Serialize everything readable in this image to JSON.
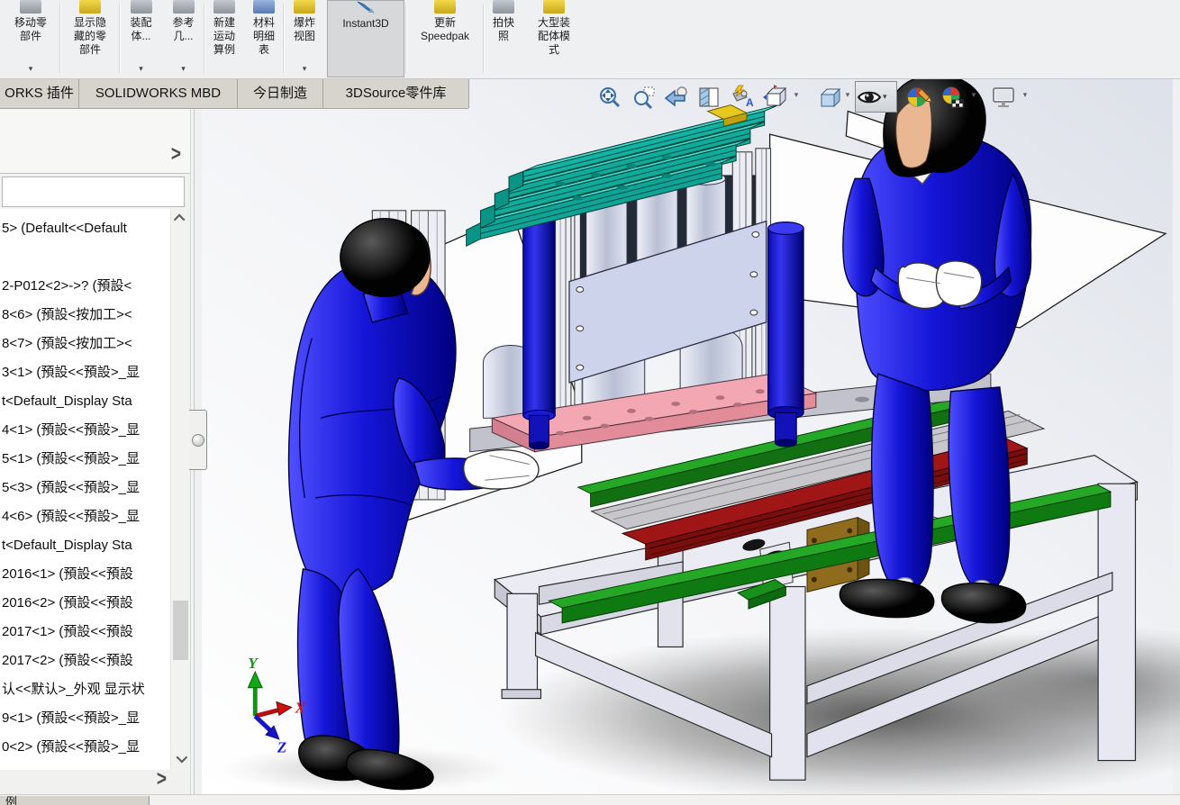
{
  "toolbar": {
    "buttons": [
      {
        "id": "move-component",
        "label": "移动零\n部件",
        "dropdown": true
      },
      {
        "id": "show-hidden-components",
        "label": "显示隐\n藏的零\n部件",
        "dropdown": false
      },
      {
        "id": "assembly-features",
        "label": "装配\n体...",
        "dropdown": true
      },
      {
        "id": "reference-geometry",
        "label": "参考\n几...",
        "dropdown": true
      },
      {
        "id": "new-motion-study",
        "label": "新建\n运动\n算例",
        "dropdown": false
      },
      {
        "id": "bill-of-materials",
        "label": "材料\n明细\n表",
        "dropdown": false
      },
      {
        "id": "exploded-view",
        "label": "爆炸\n视图",
        "dropdown": true
      },
      {
        "id": "instant3d",
        "label": "Instant3D",
        "dropdown": false,
        "pressed": true
      },
      {
        "id": "update-speedpak",
        "label": "更新\nSpeedpak",
        "dropdown": false
      },
      {
        "id": "take-snapshot",
        "label": "拍快\n照",
        "dropdown": false
      },
      {
        "id": "large-assembly-mode",
        "label": "大型装\n配体模\n式",
        "dropdown": false
      }
    ]
  },
  "tab_bar": {
    "tabs": [
      {
        "label": "ORKS 插件"
      },
      {
        "label": "SOLIDWORKS MBD"
      },
      {
        "label": "今日制造"
      },
      {
        "label": "3DSource零件库"
      }
    ]
  },
  "feature_tree": {
    "rows": [
      "5> (Default<<Default",
      "",
      "2-P012<2>->? (預設<",
      "8<6> (預設<按加工><",
      "8<7> (預設<按加工><",
      "3<1> (預設<<預設>_显",
      "t<Default_Display Sta",
      "4<1> (預設<<預設>_显",
      "5<1> (預設<<預設>_显",
      "5<3> (預設<<預設>_显",
      "4<6> (預設<<預設>_显",
      "t<Default_Display Sta",
      "2016<1> (預設<<預設",
      "2016<2> (預設<<預設",
      "2017<1> (預設<<預設",
      "2017<2> (預設<<預設",
      "认<<默认>_外观 显示状",
      "9<1> (預設<<預設>_显",
      "0<2> (預設<<預設>_显"
    ]
  },
  "headsup_toolbar": {
    "icons": [
      {
        "name": "zoom-to-fit",
        "dropdown": false
      },
      {
        "name": "zoom-to-area",
        "dropdown": false
      },
      {
        "name": "previous-view",
        "dropdown": false
      },
      {
        "name": "section-view",
        "dropdown": false
      },
      {
        "name": "annotation-views",
        "dropdown": false
      },
      {
        "name": "view-orientation",
        "dropdown": true
      },
      {
        "name": "display-style",
        "dropdown": true
      },
      {
        "name": "hide-show-items",
        "dropdown": true,
        "pressed": true
      },
      {
        "name": "edit-appearance",
        "dropdown": false
      },
      {
        "name": "apply-scene",
        "dropdown": true
      },
      {
        "name": "view-settings",
        "dropdown": true
      }
    ]
  },
  "viewport": {
    "triad": {
      "x_label": "X",
      "y_label": "Y",
      "z_label": "Z",
      "x_color": "#cc1111",
      "y_color": "#0e9612",
      "z_color": "#1515cc"
    }
  },
  "status_bar": {
    "model_tab_fragment": "例"
  },
  "icons": {
    "dropdown_arrow": "▾",
    "chevron_right": ">"
  },
  "colors": {
    "mannequin_blue": "#1414d2",
    "teal_beam": "#18c2b2",
    "rail_green": "#1f9e1f",
    "slide_red": "#8e1212",
    "plate_pink": "#f2a7b3",
    "panel_lavender": "#ccd3ea",
    "bracket_brown": "#8f6b1e",
    "accent_yellow": "#e2c51c",
    "table_gray": "#e9e9f2",
    "toolbar_bg": "#eef0f2",
    "tabrow_bg": "#d7d3cd"
  }
}
